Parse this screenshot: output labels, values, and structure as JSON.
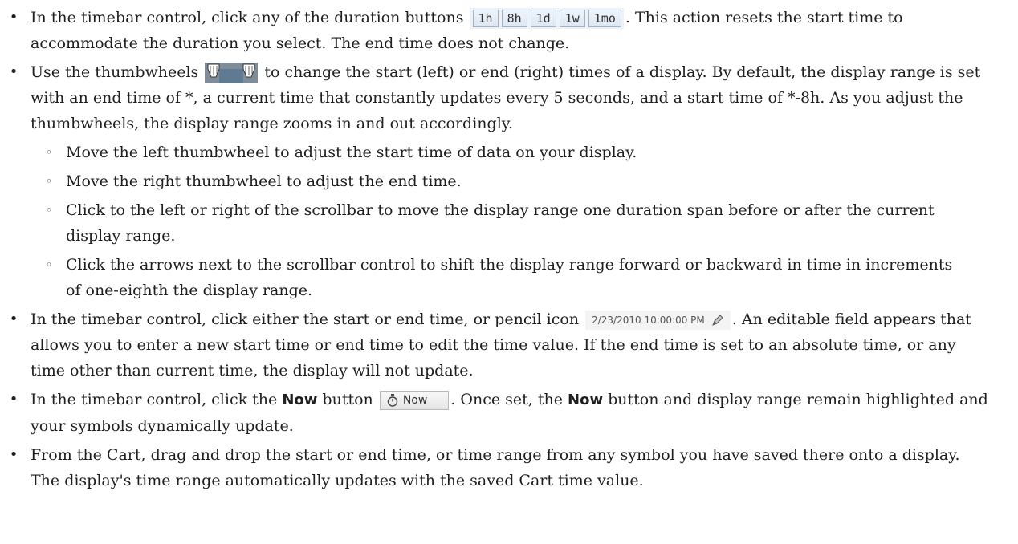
{
  "bullets": {
    "b1": {
      "before": "In the timebar control, click any of the duration buttons",
      "buttons": [
        "1h",
        "8h",
        "1d",
        "1w",
        "1mo"
      ],
      "after": ". This action resets the start time to accommodate the duration you select. The end time does not change."
    },
    "b2": {
      "before": "Use the thumbwheels",
      "after": "to change the start (left) or end (right) times of a display. By default, the display range is set with an end time of *, a current time that constantly updates every 5 seconds, and a start time of *-8h. As you adjust the thumbwheels, the display range zooms in and out accordingly.",
      "sub": [
        "Move the left thumbwheel to adjust the start time of data on your display.",
        "Move the right thumbwheel to adjust the end time.",
        "Click to the left or right of the scrollbar to move the display range one duration span before or after the current display range.",
        "Click the arrows next to the scrollbar control to shift the display range forward or backward in time in increments of one-eighth the display range."
      ]
    },
    "b3": {
      "before": "In the timebar control, click either the start or end time, or pencil icon",
      "time_value": "2/23/2010 10:00:00 PM",
      "after": ". An editable field appears that allows you to enter a new start time or end time to edit the time value. If the end time is set to an absolute time, or any time other than current time, the display will not update."
    },
    "b4": {
      "before": "In the timebar control, click the",
      "now_bold": "Now",
      "mid": "button",
      "now_label": "Now",
      "after1": ". Once set, the",
      "now_bold2": "Now",
      "after2": "button and display range remain highlighted and your symbols dynamically update."
    },
    "b5": {
      "text": "From the Cart, drag and drop the start or end time, or time range from any symbol you have saved there onto a display. The display's time range automatically updates with the saved Cart time value."
    }
  }
}
